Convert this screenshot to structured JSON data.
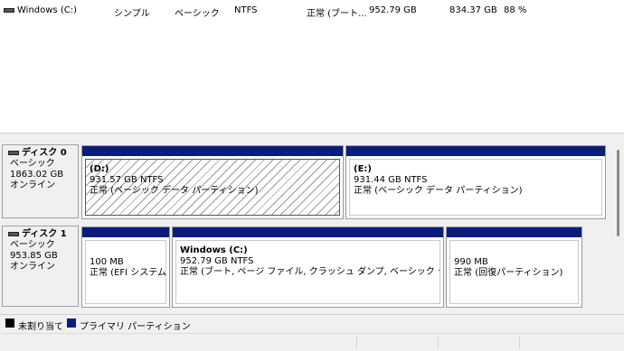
{
  "volume_list": {
    "rows": [
      {
        "volume": "Windows (C:)",
        "layout": "シンプル",
        "type": "ベーシック",
        "filesystem": "NTFS",
        "status": "正常 (ブート...",
        "capacity": "952.79 GB",
        "free": "834.37 GB",
        "percent_free": "88 %"
      }
    ]
  },
  "disks": [
    {
      "title": "ディスク 0",
      "type": "ベーシック",
      "size": "1863.02 GB",
      "state": "オンライン",
      "partitions": [
        {
          "name": "(D:)",
          "size_fs": "931.57 GB NTFS",
          "status": "正常 (ベーシック データ パーティション)",
          "selected": true
        },
        {
          "name": "(E:)",
          "size_fs": "931.44 GB NTFS",
          "status": "正常 (ベーシック データ パーティション)",
          "selected": false
        }
      ]
    },
    {
      "title": "ディスク 1",
      "type": "ベーシック",
      "size": "953.85 GB",
      "state": "オンライン",
      "partitions": [
        {
          "name": "",
          "size_fs": "100 MB",
          "status": "正常 (EFI システム /"
        },
        {
          "name": "Windows  (C:)",
          "size_fs": "952.79 GB NTFS",
          "status": "正常 (ブート, ページ ファイル, クラッシュ ダンプ, ベーシック データ パーテ"
        },
        {
          "name": "",
          "size_fs": "990 MB",
          "status": "正常 (回復パーティション)"
        }
      ]
    }
  ],
  "legend": {
    "unallocated": "未割り当て",
    "primary": "プライマリ パーティション",
    "unallocated_color": "#000000",
    "primary_color": "#0a1d7c"
  }
}
